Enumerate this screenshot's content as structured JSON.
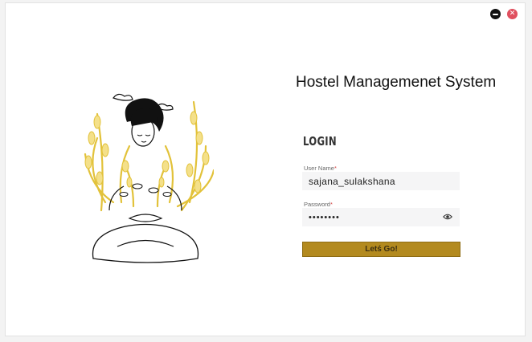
{
  "window": {
    "close_glyph": "✕"
  },
  "app": {
    "title": "Hostel Managemenet System"
  },
  "login": {
    "heading": "LOGIN",
    "username_label": "User Name",
    "username_value": "sajana_sulakshana",
    "password_label": "Password",
    "required_mark": "*",
    "password_masked": "••••••••",
    "submit_label": "Letś Go!"
  },
  "icons": {
    "minimize": "minimize-icon",
    "close": "close-icon",
    "password_toggle": "eye-icon",
    "illustration": "meditating-person-illustration"
  },
  "colors": {
    "accent": "#b38a1f",
    "illustration_gold": "#e2c23a",
    "close_button": "#e0505f",
    "field_bg": "#f5f5f6"
  }
}
